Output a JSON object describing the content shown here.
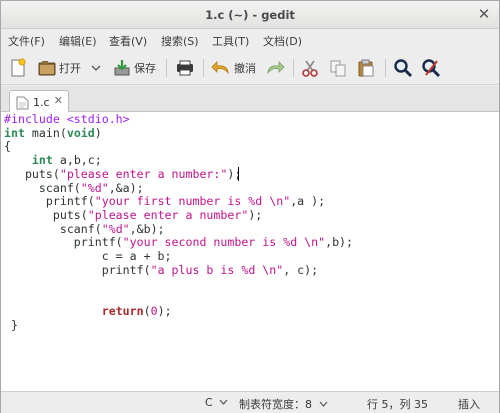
{
  "window": {
    "title": "1.c (~) - gedit"
  },
  "menubar": [
    {
      "id": "file",
      "label": "文件(F)"
    },
    {
      "id": "edit",
      "label": "编辑(E)"
    },
    {
      "id": "view",
      "label": "查看(V)"
    },
    {
      "id": "search",
      "label": "搜索(S)"
    },
    {
      "id": "tools",
      "label": "工具(T)"
    },
    {
      "id": "docs",
      "label": "文档(D)"
    }
  ],
  "toolbar": {
    "open_label": "打开",
    "save_label": "保存",
    "undo_label": "撤消"
  },
  "tab": {
    "label": "1.c"
  },
  "editor": {
    "lines": [
      [
        {
          "t": "#include <stdio.h>",
          "c": "pp"
        }
      ],
      [
        {
          "t": "int",
          "c": "type"
        },
        {
          "t": " main("
        },
        {
          "t": "void",
          "c": "type"
        },
        {
          "t": ")"
        }
      ],
      [
        {
          "t": "{"
        }
      ],
      [
        {
          "t": "    "
        },
        {
          "t": "int",
          "c": "type"
        },
        {
          "t": " a,b,c;"
        }
      ],
      [
        {
          "t": "   puts("
        },
        {
          "t": "\"please enter a number:\"",
          "c": "str"
        },
        {
          "t": ");"
        }
      ],
      [
        {
          "t": "     scanf("
        },
        {
          "t": "\"%d\"",
          "c": "str"
        },
        {
          "t": ",&a);"
        }
      ],
      [
        {
          "t": "      printf("
        },
        {
          "t": "\"your first number is %d \\n\"",
          "c": "str"
        },
        {
          "t": ",a );"
        }
      ],
      [
        {
          "t": "       puts("
        },
        {
          "t": "\"please enter a number\"",
          "c": "str"
        },
        {
          "t": ");"
        }
      ],
      [
        {
          "t": "        scanf("
        },
        {
          "t": "\"%d\"",
          "c": "str"
        },
        {
          "t": ",&b);"
        }
      ],
      [
        {
          "t": "          printf("
        },
        {
          "t": "\"your second number is %d \\n\"",
          "c": "str"
        },
        {
          "t": ",b);"
        }
      ],
      [
        {
          "t": "              c = a + b;"
        }
      ],
      [
        {
          "t": "              printf("
        },
        {
          "t": "\"a plus b is %d \\n\"",
          "c": "str"
        },
        {
          "t": ", c);"
        }
      ],
      [
        {
          "t": ""
        }
      ],
      [
        {
          "t": ""
        }
      ],
      [
        {
          "t": "              "
        },
        {
          "t": "return",
          "c": "ret"
        },
        {
          "t": "("
        },
        {
          "t": "0",
          "c": "num"
        },
        {
          "t": ");"
        }
      ],
      [
        {
          "t": " }"
        }
      ]
    ]
  },
  "statusbar": {
    "language": "C",
    "tab_width": "制表符宽度：8",
    "position": "行 5，列 35",
    "mode": "插入"
  },
  "colors": {
    "keyword": "#2e8b57",
    "preprocessor": "#a020f0",
    "string": "#c0148c",
    "return": "#a52a2a"
  }
}
